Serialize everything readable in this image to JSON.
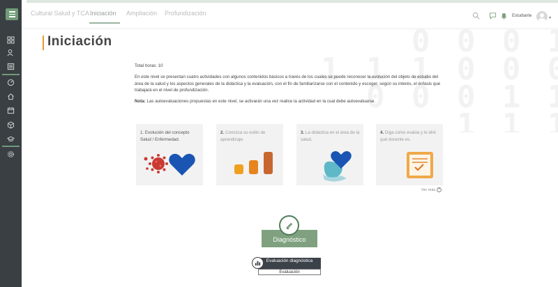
{
  "header": {
    "tabs": [
      {
        "label": "Cultural Salud y TCA",
        "active": false
      },
      {
        "label": "Iniciación",
        "active": true
      },
      {
        "label": "Ampliación",
        "active": false
      },
      {
        "label": "Profundización",
        "active": false
      }
    ],
    "user_label": "Estudiante"
  },
  "page": {
    "title": "Iniciación",
    "total_hours": "Total horas: 10",
    "intro": "En este nivel se presentan cuatro actividades con algunos contenidos básicos a través de los cuales se puede reconocer la evolución del objeto de estudio del área de la salud y los aspectos generales de la didáctica y la evaluación, con el fin de familiarizarse con el contenido y escoger, según su interés, el énfasis que trabajará en el nivel de profundización.",
    "note_label": "Nota:",
    "note_text": "Las autoevaluaciones propuestas en este nivel, se activarán una vez realice la actividad en la cual debe autoevaluarse."
  },
  "cards": [
    {
      "number": "1.",
      "text": "Evolución del concepto Salud / Enfermedad.",
      "icon": "virus-heart-icon"
    },
    {
      "number": "2.",
      "text": "Conozca su estilo de aprendizaje.",
      "icon": "bar-steps-icon"
    },
    {
      "number": "3.",
      "text": "La didáctica en el área de la salud.",
      "icon": "hand-heart-icon"
    },
    {
      "number": "4.",
      "text": "Diga cómo evalúa y le diré qué docente es.",
      "icon": "checklist-icon"
    }
  ],
  "ver_mas": "Ver más",
  "diagnostic": {
    "label": "Diagnóstico"
  },
  "evaluation": {
    "title": "Evaluación diagnóstica",
    "subtitle": "Evaluación"
  },
  "colors": {
    "sidebar": "#3a3f44",
    "accent_green": "#7fa17f",
    "title_accent": "#e29a2d"
  }
}
